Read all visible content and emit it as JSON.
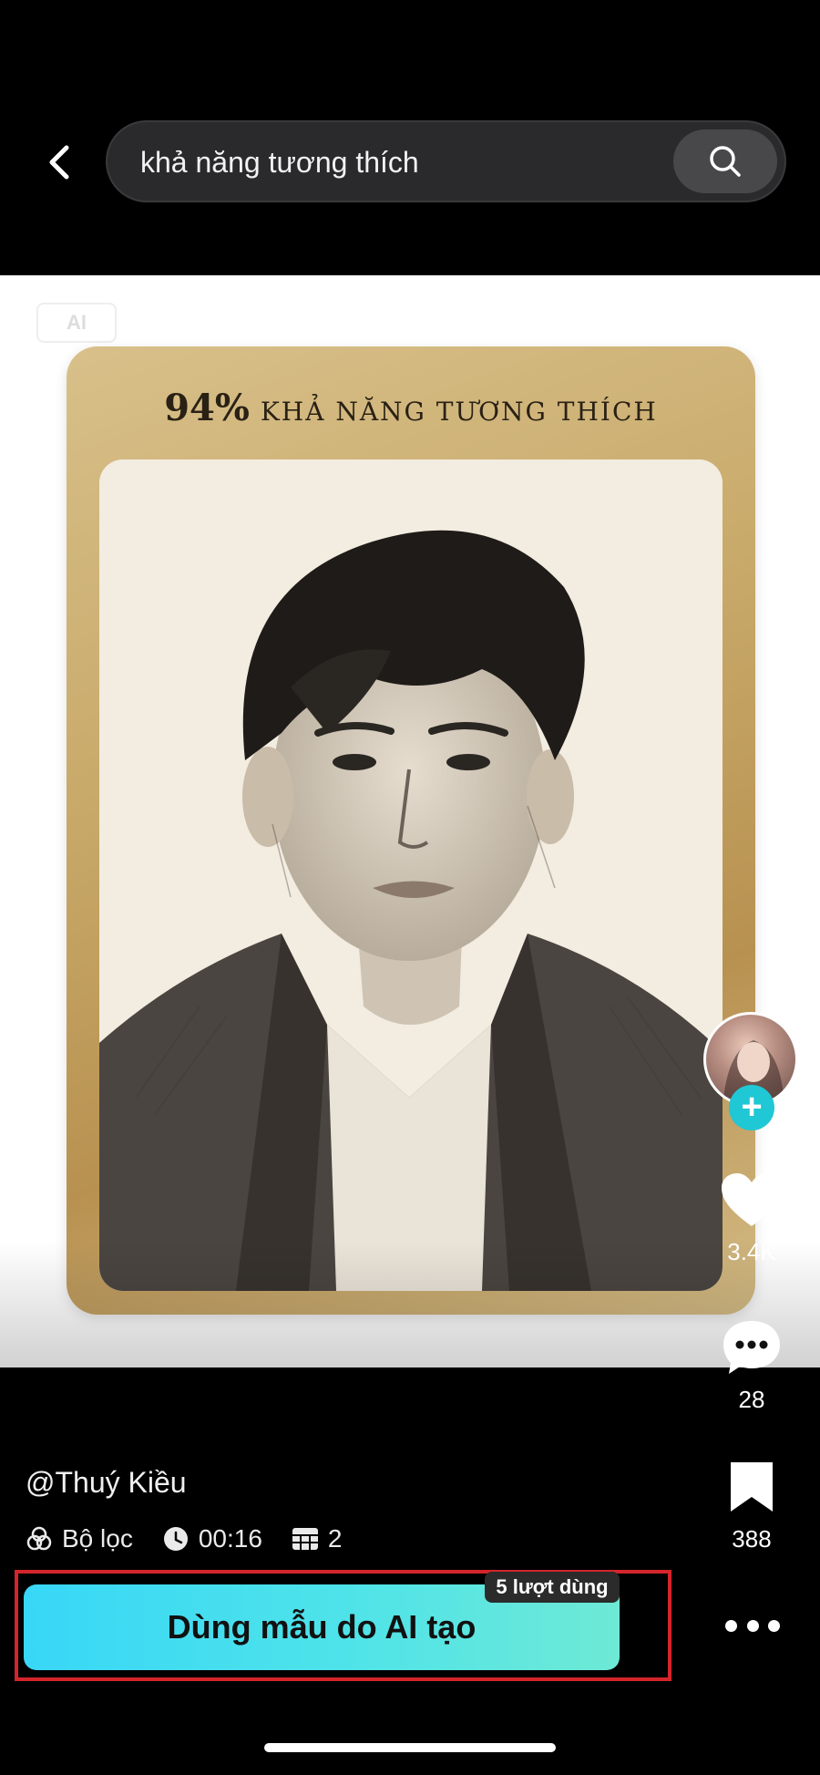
{
  "header": {
    "search_query": "khả năng tương thích"
  },
  "media": {
    "watermark": "AI",
    "card_percent": "94%",
    "card_title": "KHẢ NĂNG TƯƠNG THÍCH"
  },
  "sidebar": {
    "likes": "3.4K",
    "comments": "28",
    "saves": "388"
  },
  "post": {
    "username": "@Thuý Kiều",
    "filter_label": "Bộ lọc",
    "duration": "00:16",
    "photo_count": "2"
  },
  "cta": {
    "label": "Dùng mẫu do AI tạo",
    "usage_badge": "5 lượt dùng"
  },
  "colors": {
    "cta_gradient_start": "#38d7f7",
    "cta_gradient_end": "#6ee9d5",
    "highlight_frame": "#d3252b",
    "follow_accent": "#20c7d4"
  }
}
